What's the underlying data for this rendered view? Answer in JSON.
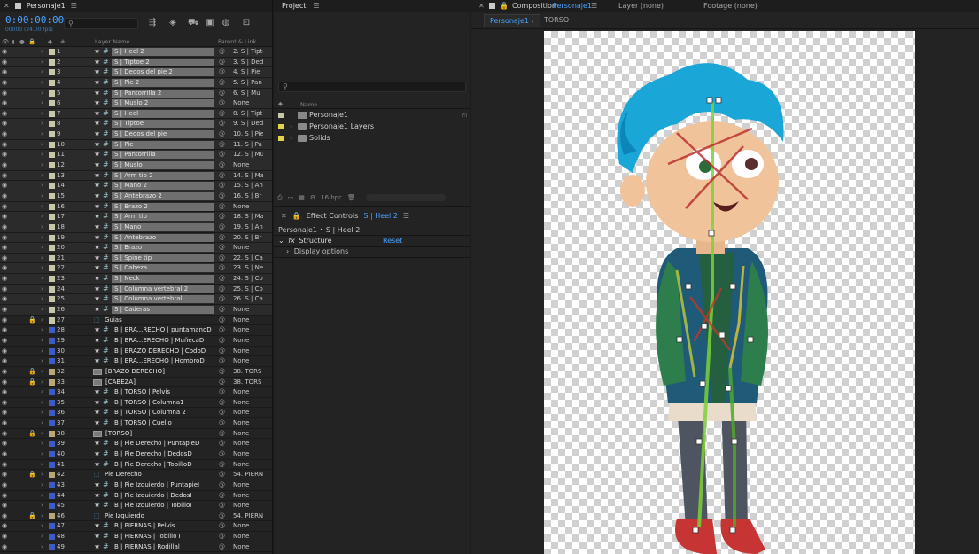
{
  "timeline": {
    "tab_title": "Personaje1",
    "timecode": "0:00:00:00",
    "fps": "00000 (24.00 fps)",
    "search_placeholder": "",
    "columns": {
      "num": "#",
      "layer_name": "Layer Name",
      "parent": "Parent & Link"
    },
    "layers": [
      {
        "n": "1",
        "name": "S | Heel 2",
        "parent": "2. S | Tipto",
        "color": "#c8c8a8",
        "sel": true,
        "type": "puppet"
      },
      {
        "n": "2",
        "name": "S | Tiptoe 2",
        "parent": "3. S | Ded",
        "color": "#c8c8a8",
        "sel": true,
        "type": "puppet"
      },
      {
        "n": "3",
        "name": "S | Dedos del pie 2",
        "parent": "4. S | Pie",
        "color": "#c8c8a8",
        "sel": true,
        "type": "puppet"
      },
      {
        "n": "4",
        "name": "S | Pie 2",
        "parent": "5. S | Pan",
        "color": "#c8c8a8",
        "sel": true,
        "type": "puppet"
      },
      {
        "n": "5",
        "name": "S | Pantorrilla 2",
        "parent": "6. S | Mu",
        "color": "#c8c8a8",
        "sel": true,
        "type": "puppet"
      },
      {
        "n": "6",
        "name": "S | Muslo 2",
        "parent": "None",
        "color": "#c8c8a8",
        "sel": true,
        "type": "puppet"
      },
      {
        "n": "7",
        "name": "S | Heel",
        "parent": "8. S | Tipt",
        "color": "#c8c8a8",
        "sel": true,
        "type": "puppet"
      },
      {
        "n": "8",
        "name": "S | Tiptoe",
        "parent": "9. S | Ded",
        "color": "#c8c8a8",
        "sel": true,
        "type": "puppet"
      },
      {
        "n": "9",
        "name": "S | Dedos del pie",
        "parent": "10. S | Pie",
        "color": "#c8c8a8",
        "sel": true,
        "type": "puppet"
      },
      {
        "n": "10",
        "name": "S | Pie",
        "parent": "11. S | Pa",
        "color": "#c8c8a8",
        "sel": true,
        "type": "puppet"
      },
      {
        "n": "11",
        "name": "S | Pantorrilla",
        "parent": "12. S | Mu",
        "color": "#c8c8a8",
        "sel": true,
        "type": "puppet"
      },
      {
        "n": "12",
        "name": "S | Muslo",
        "parent": "None",
        "color": "#c8c8a8",
        "sel": true,
        "type": "puppet"
      },
      {
        "n": "13",
        "name": "S | Arm tip 2",
        "parent": "14. S | Ma",
        "color": "#c8c8a8",
        "sel": true,
        "type": "puppet"
      },
      {
        "n": "14",
        "name": "S | Mano 2",
        "parent": "15. S | An",
        "color": "#c8c8a8",
        "sel": true,
        "type": "puppet"
      },
      {
        "n": "15",
        "name": "S | Antebrazo 2",
        "parent": "16. S | Br",
        "color": "#c8c8a8",
        "sel": true,
        "type": "puppet"
      },
      {
        "n": "16",
        "name": "S | Brazo 2",
        "parent": "None",
        "color": "#c8c8a8",
        "sel": true,
        "type": "puppet"
      },
      {
        "n": "17",
        "name": "S | Arm tip",
        "parent": "18. S | Ma",
        "color": "#c8c8a8",
        "sel": true,
        "type": "puppet"
      },
      {
        "n": "18",
        "name": "S | Mano",
        "parent": "19. S | An",
        "color": "#c8c8a8",
        "sel": true,
        "type": "puppet"
      },
      {
        "n": "19",
        "name": "S | Antebrazo",
        "parent": "20. S | Br",
        "color": "#c8c8a8",
        "sel": true,
        "type": "puppet"
      },
      {
        "n": "20",
        "name": "S | Brazo",
        "parent": "None",
        "color": "#c8c8a8",
        "sel": true,
        "type": "puppet"
      },
      {
        "n": "21",
        "name": "S | Spine tip",
        "parent": "22. S | Ca",
        "color": "#c8c8a8",
        "sel": true,
        "type": "puppet"
      },
      {
        "n": "22",
        "name": "S | Cabeza",
        "parent": "23. S | Ne",
        "color": "#c8c8a8",
        "sel": true,
        "type": "puppet"
      },
      {
        "n": "23",
        "name": "S | Neck",
        "parent": "24. S | Co",
        "color": "#c8c8a8",
        "sel": true,
        "type": "puppet"
      },
      {
        "n": "24",
        "name": "S | Columna vertebral 2",
        "parent": "25. S | Co",
        "color": "#c8c8a8",
        "sel": true,
        "type": "puppet"
      },
      {
        "n": "25",
        "name": "S | Columna vertebral",
        "parent": "26. S | Ca",
        "color": "#c8c8a8",
        "sel": true,
        "type": "puppet"
      },
      {
        "n": "26",
        "name": "S | Caderas",
        "parent": "None",
        "color": "#c8c8a8",
        "sel": true,
        "type": "puppet"
      },
      {
        "n": "27",
        "name": "Guias",
        "parent": "None",
        "color": "#c8c8a8",
        "sel": false,
        "type": "null",
        "locked": true
      },
      {
        "n": "28",
        "name": "B | BRA...RECHO | puntamanoD",
        "parent": "None",
        "color": "#3d5bc8",
        "sel": false,
        "type": "puppet"
      },
      {
        "n": "29",
        "name": "B | BRA...ERECHO | MuñecaD",
        "parent": "None",
        "color": "#3d5bc8",
        "sel": false,
        "type": "puppet"
      },
      {
        "n": "30",
        "name": "B | BRAZO DERECHO | CodoD",
        "parent": "None",
        "color": "#3d5bc8",
        "sel": false,
        "type": "puppet"
      },
      {
        "n": "31",
        "name": "B | BRA...ERECHO | HombroD",
        "parent": "None",
        "color": "#3d5bc8",
        "sel": false,
        "type": "puppet"
      },
      {
        "n": "32",
        "name": "[BRAZO DERECHO]",
        "parent": "38. TORS",
        "color": "#b8a878",
        "sel": false,
        "type": "comp",
        "locked": true
      },
      {
        "n": "33",
        "name": "[CABEZA]",
        "parent": "38. TORS",
        "color": "#b8a878",
        "sel": false,
        "type": "comp",
        "locked": true
      },
      {
        "n": "34",
        "name": "B | TORSO | Pelvis",
        "parent": "None",
        "color": "#3d5bc8",
        "sel": false,
        "type": "puppet"
      },
      {
        "n": "35",
        "name": "B | TORSO | Columna1",
        "parent": "None",
        "color": "#3d5bc8",
        "sel": false,
        "type": "puppet"
      },
      {
        "n": "36",
        "name": "B | TORSO | Columna 2",
        "parent": "None",
        "color": "#3d5bc8",
        "sel": false,
        "type": "puppet"
      },
      {
        "n": "37",
        "name": "B | TORSO | Cuello",
        "parent": "None",
        "color": "#3d5bc8",
        "sel": false,
        "type": "puppet"
      },
      {
        "n": "38",
        "name": "[TORSO]",
        "parent": "None",
        "color": "#b8a878",
        "sel": false,
        "type": "comp",
        "locked": true
      },
      {
        "n": "39",
        "name": "B | Pie Derecho | PuntapieD",
        "parent": "None",
        "color": "#3d5bc8",
        "sel": false,
        "type": "puppet"
      },
      {
        "n": "40",
        "name": "B | Pie Derecho | DedosD",
        "parent": "None",
        "color": "#3d5bc8",
        "sel": false,
        "type": "puppet"
      },
      {
        "n": "41",
        "name": "B | Pie Derecho | TobilloD",
        "parent": "None",
        "color": "#3d5bc8",
        "sel": false,
        "type": "puppet"
      },
      {
        "n": "42",
        "name": "Pie Derecho",
        "parent": "54. PIERN",
        "color": "#b8a878",
        "sel": false,
        "type": "null",
        "locked": true
      },
      {
        "n": "43",
        "name": "B | Pie Izquierdo | PuntapieI",
        "parent": "None",
        "color": "#3d5bc8",
        "sel": false,
        "type": "puppet"
      },
      {
        "n": "44",
        "name": "B | Pie Izquierdo | DedosI",
        "parent": "None",
        "color": "#3d5bc8",
        "sel": false,
        "type": "puppet"
      },
      {
        "n": "45",
        "name": "B | Pie Izquierdo | TobilloI",
        "parent": "None",
        "color": "#3d5bc8",
        "sel": false,
        "type": "puppet"
      },
      {
        "n": "46",
        "name": "Pie Izquierdo",
        "parent": "54. PIERN",
        "color": "#b8a878",
        "sel": false,
        "type": "null",
        "locked": true
      },
      {
        "n": "47",
        "name": "B | PIERNAS | Pelvis",
        "parent": "None",
        "color": "#3d5bc8",
        "sel": false,
        "type": "puppet"
      },
      {
        "n": "48",
        "name": "B | PIERNAS | Tobillo I",
        "parent": "None",
        "color": "#3d5bc8",
        "sel": false,
        "type": "puppet"
      },
      {
        "n": "49",
        "name": "B | PIERNAS | Rodillal",
        "parent": "None",
        "color": "#3d5bc8",
        "sel": false,
        "type": "puppet"
      }
    ]
  },
  "project": {
    "tab_title": "Project",
    "name_column": "Name",
    "items": [
      {
        "label": "Personaje1",
        "color": "#c8c8a8",
        "type": "comp"
      },
      {
        "label": "Personaje1 Layers",
        "color": "#e3d349",
        "type": "folder"
      },
      {
        "label": "Solids",
        "color": "#e3d349",
        "type": "folder"
      }
    ],
    "bpc": "16 bpc"
  },
  "effects": {
    "tab_prefix": "Effect Controls",
    "tab_layer": "S | Heel 2",
    "subtitle": "Personaje1 • S | Heel 2",
    "effect_name": "Structure",
    "reset_label": "Reset",
    "display_options": "Display options"
  },
  "composition": {
    "tab_prefix": "Composition",
    "tab_name": "Personaje1",
    "layer_tab": "Layer (none)",
    "footage_tab": "Footage (none)",
    "sub_tab_active": "Personaje1",
    "sub_tab_other": "TORSO"
  }
}
